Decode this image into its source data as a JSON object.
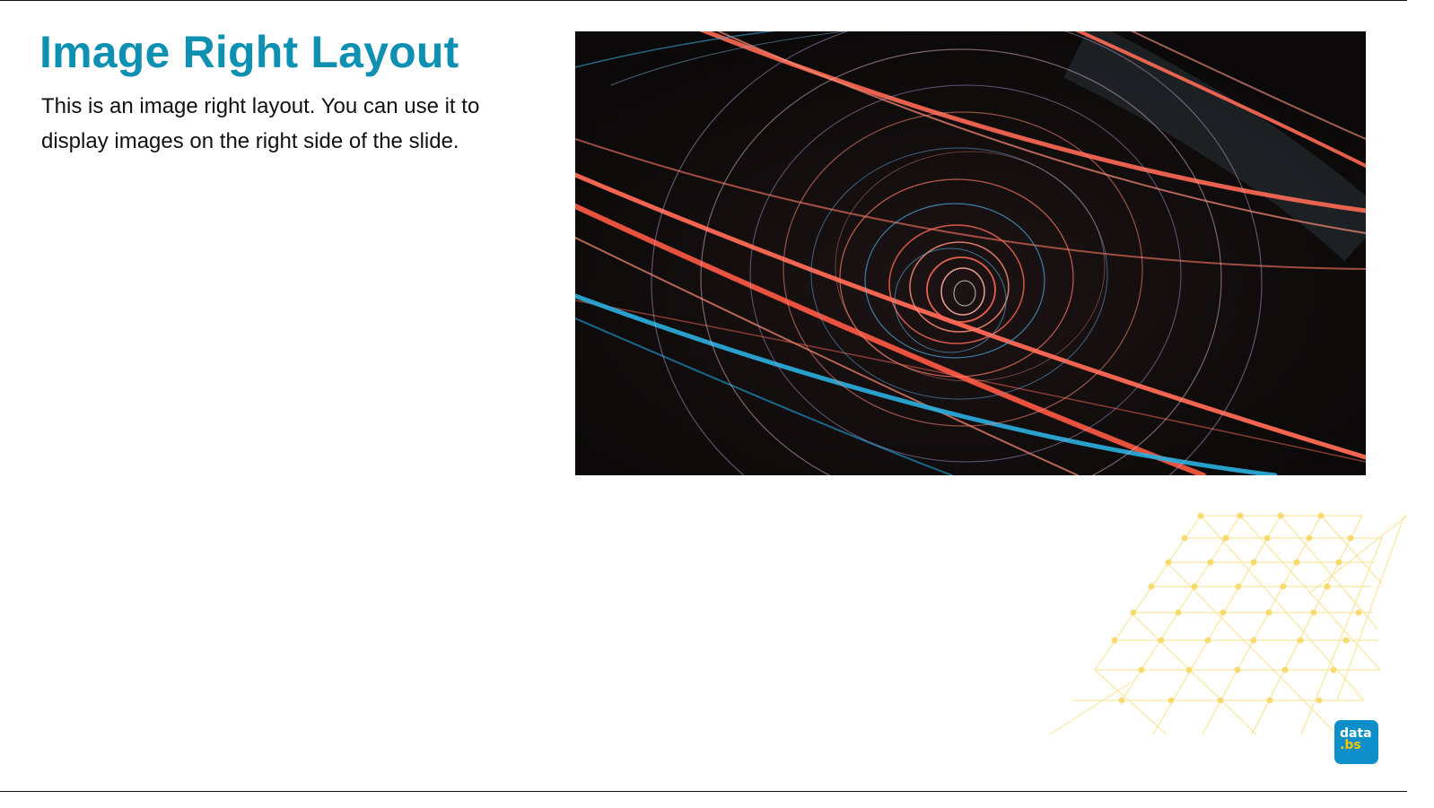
{
  "slide": {
    "title": "Image Right Layout",
    "body": "This is an image right layout. You can use it to display images on the right side of the slide."
  },
  "image": {
    "icon": "light-trails-photo",
    "colors": {
      "background": "#0f0b0c",
      "warm": "#ff6a55",
      "cool": "#2bb0e0",
      "violet": "#c7a7e0"
    }
  },
  "decoration": {
    "icon": "yellow-network-grid",
    "color": "#f7d75e"
  },
  "logo": {
    "line1": "data",
    "line2": ".bs",
    "colors": {
      "badge": "#0f8fca",
      "accent": "#f6c500"
    }
  },
  "colors": {
    "title": "#0e90b3",
    "text": "#111111"
  }
}
